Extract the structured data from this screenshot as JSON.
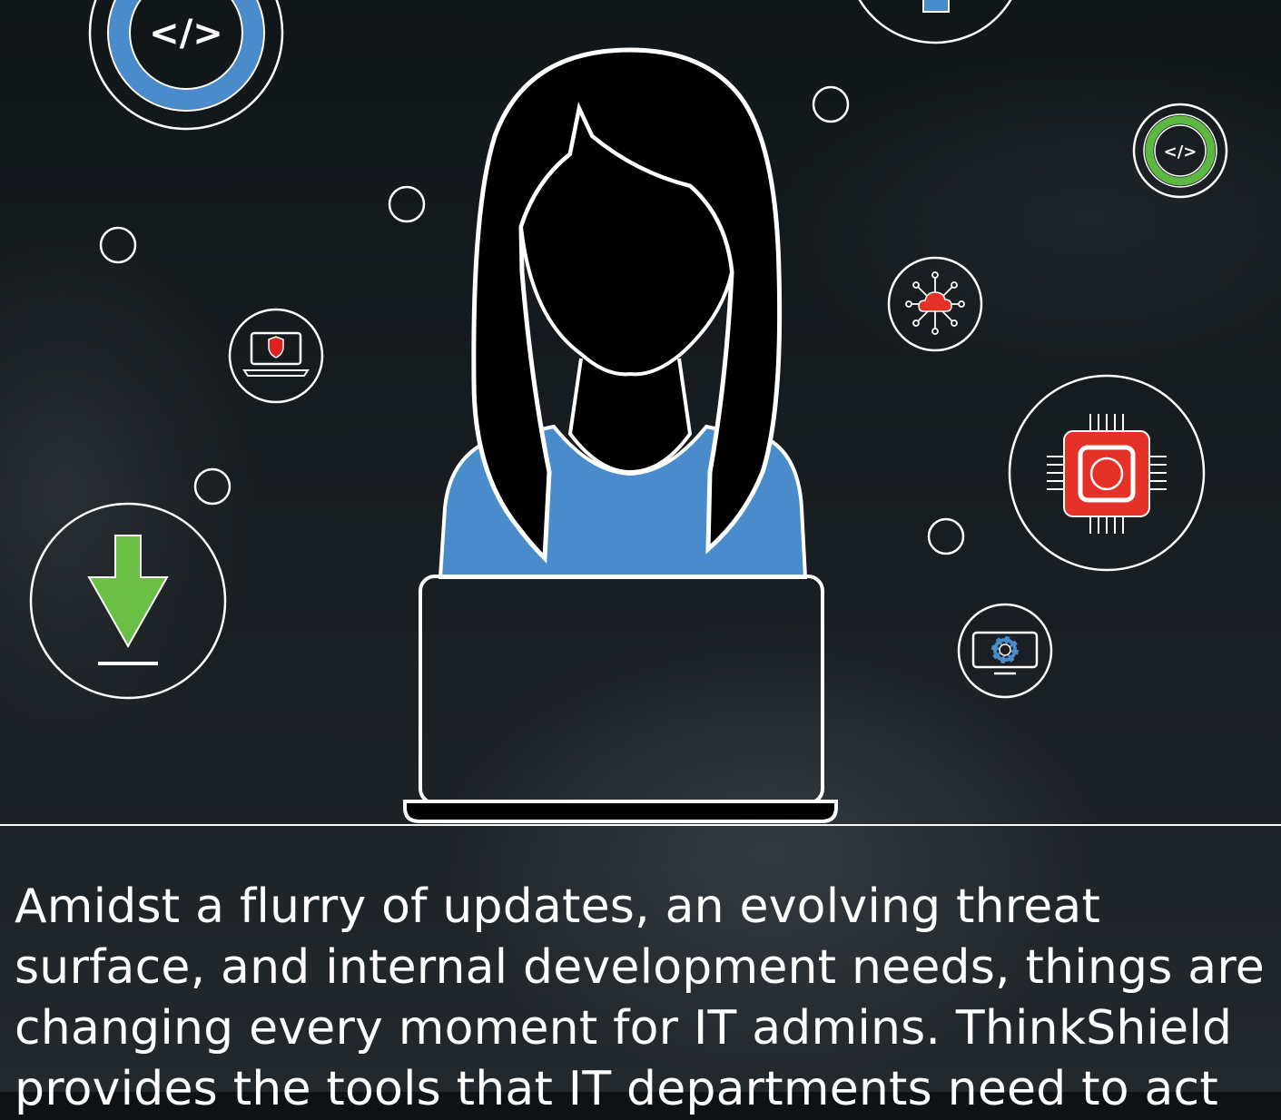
{
  "icons": {
    "code_large": {
      "name": "code-icon",
      "glyph": "</>",
      "accent": "#4a8ccb"
    },
    "code_small": {
      "name": "code-icon",
      "glyph": "</>",
      "accent": "#5cb840"
    },
    "laptop_shield": {
      "name": "laptop-shield-icon",
      "accent": "#e02020"
    },
    "download": {
      "name": "download-arrow-icon",
      "accent": "#6bbf45"
    },
    "cloud_network": {
      "name": "cloud-network-icon",
      "accent": "#e53228"
    },
    "chip": {
      "name": "chip-icon",
      "accent": "#e53228"
    },
    "monitor_gear": {
      "name": "monitor-gear-icon",
      "accent": "#4a8ccb"
    },
    "top_partial": {
      "name": "partial-circle-icon",
      "accent": "#4a8ccb"
    }
  },
  "person": {
    "shirt_color": "#4a8ccb",
    "outline_color": "#ffffff",
    "fill_color": "#000000"
  },
  "caption": {
    "text": "Amidst a flurry of updates, an evolving threat surface, and internal development needs, things are changing every moment for IT admins. ThinkShield provides the tools that IT departments need to act"
  }
}
